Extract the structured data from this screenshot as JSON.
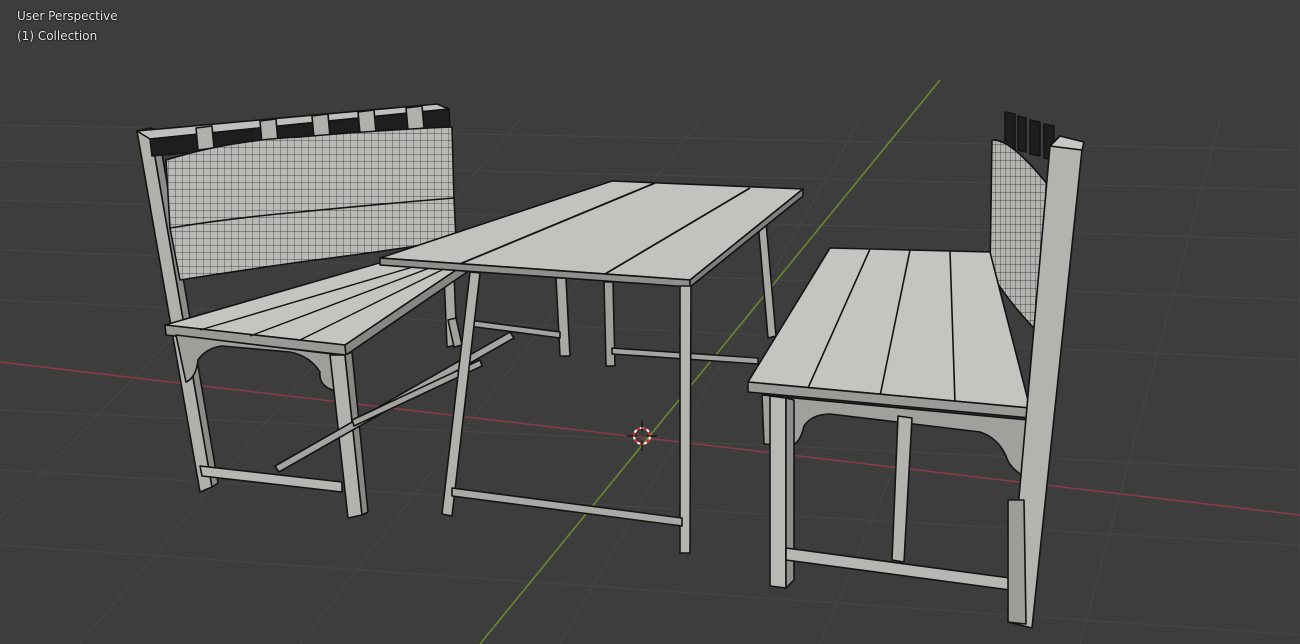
{
  "viewport": {
    "view_name": "User Perspective",
    "collection_name": "(1) Collection"
  },
  "icons": {
    "cursor": "3d-cursor-icon"
  },
  "colors": {
    "background": "#3d3d3d",
    "grid_line": "#474747",
    "x_axis": "#8a3d44",
    "y_axis": "#6c8c2e",
    "model_surface": "#a9aaa6",
    "model_surface_light": "#c6c7c3",
    "model_surface_dark": "#7b7c78",
    "wire": "#141414",
    "cushion": "#b8b8b4"
  }
}
